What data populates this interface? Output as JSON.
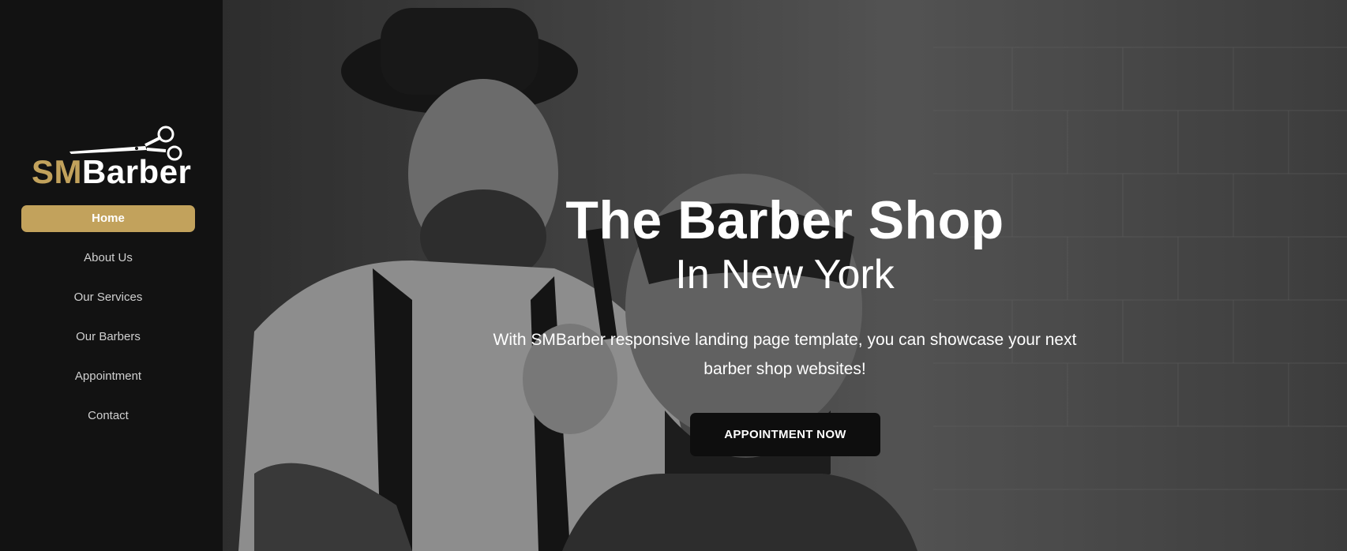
{
  "brand": {
    "logo_sm": "SM",
    "logo_barber": "Barber",
    "accent_color": "#c2a25c",
    "logo_icon": "scissors-icon"
  },
  "nav": {
    "items": [
      {
        "label": "Home",
        "active": true
      },
      {
        "label": "About Us",
        "active": false
      },
      {
        "label": "Our Services",
        "active": false
      },
      {
        "label": "Our Barbers",
        "active": false
      },
      {
        "label": "Appointment",
        "active": false
      },
      {
        "label": "Contact",
        "active": false
      }
    ]
  },
  "hero": {
    "title": "The Barber Shop",
    "subtitle": "In New York",
    "text": "With SMBarber responsive landing page template, you can showcase your next barber shop websites!",
    "cta_label": "APPOINTMENT NOW",
    "cta_color": "#0e0e0e"
  }
}
